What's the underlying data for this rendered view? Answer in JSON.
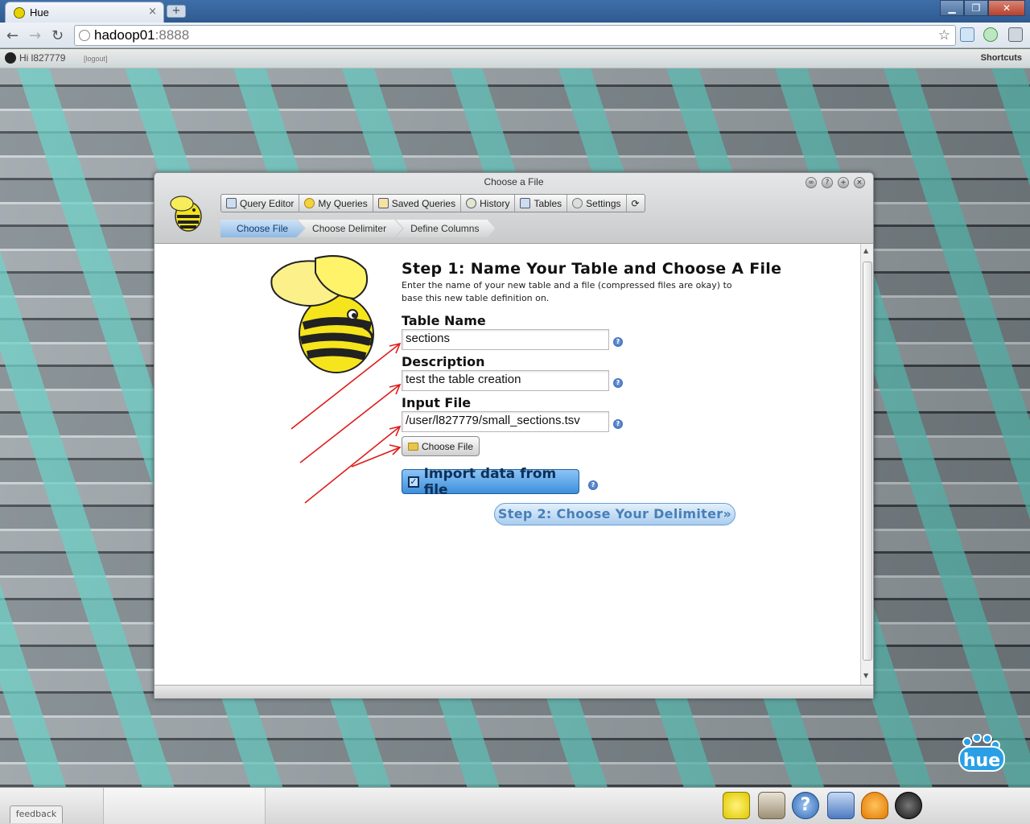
{
  "browser": {
    "tab_title": "Hue",
    "tab_close": "×",
    "new_tab": "+",
    "url_host": "hadoop01",
    "url_port": ":8888",
    "controls": [
      "▁",
      "❐",
      "✕"
    ]
  },
  "huebar": {
    "greeting": "Hi l827779",
    "logout": "[logout]",
    "shortcuts": "Shortcuts"
  },
  "window": {
    "title": "Choose a File",
    "nav": [
      {
        "label": "Query Editor",
        "icon": "query-editor-icon"
      },
      {
        "label": "My Queries",
        "icon": "star-icon"
      },
      {
        "label": "Saved Queries",
        "icon": "saved-queries-icon"
      },
      {
        "label": "History",
        "icon": "clock-icon"
      },
      {
        "label": "Tables",
        "icon": "tables-icon"
      },
      {
        "label": "Settings",
        "icon": "gear-icon"
      }
    ],
    "refresh": "⟳",
    "breadcrumbs": [
      "Choose File",
      "Choose Delimiter",
      "Define Columns"
    ]
  },
  "form": {
    "heading": "Step 1: Name Your Table and Choose A File",
    "intro": "Enter the name of your new table and a file (compressed files are okay) to base this new table definition on.",
    "table_name_label": "Table Name",
    "table_name_value": "sections",
    "description_label": "Description",
    "description_value": "test the table creation",
    "input_file_label": "Input File",
    "input_file_value": "/user/l827779/small_sections.tsv",
    "choose_file_button": "Choose File",
    "import_label": "Import data from file",
    "import_checked": true,
    "next_button": "Step 2: Choose Your Delimiter»",
    "help_glyph": "?"
  },
  "dock": {
    "feedback": "feedback",
    "icons": [
      "beeswax-icon",
      "file-browser-icon",
      "help-icon",
      "job-designer-icon",
      "job-browser-icon",
      "user-admin-icon"
    ]
  },
  "brand": {
    "logo_text": "hue"
  }
}
